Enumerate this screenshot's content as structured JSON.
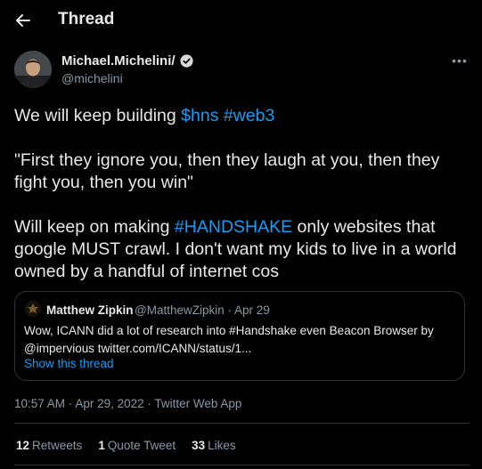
{
  "header": {
    "title": "Thread"
  },
  "tweet": {
    "author_name": "Michael.Michelini/",
    "author_handle": "@michelini",
    "line1_prefix": "We will keep building ",
    "line1_tag1": "$hns",
    "line1_space": " ",
    "line1_tag2": "#web3",
    "line2": "\"First they ignore you, then they laugh at you, then they fight you, then you win\"",
    "line3_prefix": "Will keep on making ",
    "line3_tag": "#HANDSHAKE",
    "line3_suffix": " only websites that google MUST crawl. I don't want my kids to live in a world owned by a handful of internet cos"
  },
  "quote": {
    "author_name": "Matthew Zipkin",
    "meta": "@MatthewZipkin · Apr 29",
    "text": "Wow, ICANN did a lot of research into #Handshake even Beacon Browser by @impervious twitter.com/ICANN/status/1...",
    "show_thread": "Show this thread"
  },
  "timestamp": {
    "time": "10:57 AM",
    "sep1": " · ",
    "date": "Apr 29, 2022",
    "sep2": " · ",
    "source": "Twitter Web App"
  },
  "stats": {
    "retweets_count": "12",
    "retweets_label": "Retweets",
    "quotes_count": "1",
    "quotes_label": "Quote Tweet",
    "likes_count": "33",
    "likes_label": "Likes"
  },
  "colors": {
    "background": "#000000",
    "text": "#e7e9ea",
    "secondary": "#8b98a5",
    "accent": "#1d9bf0",
    "border": "#2f3336"
  },
  "icons": [
    "back-arrow-icon",
    "verified-badge-icon",
    "more-icon"
  ]
}
